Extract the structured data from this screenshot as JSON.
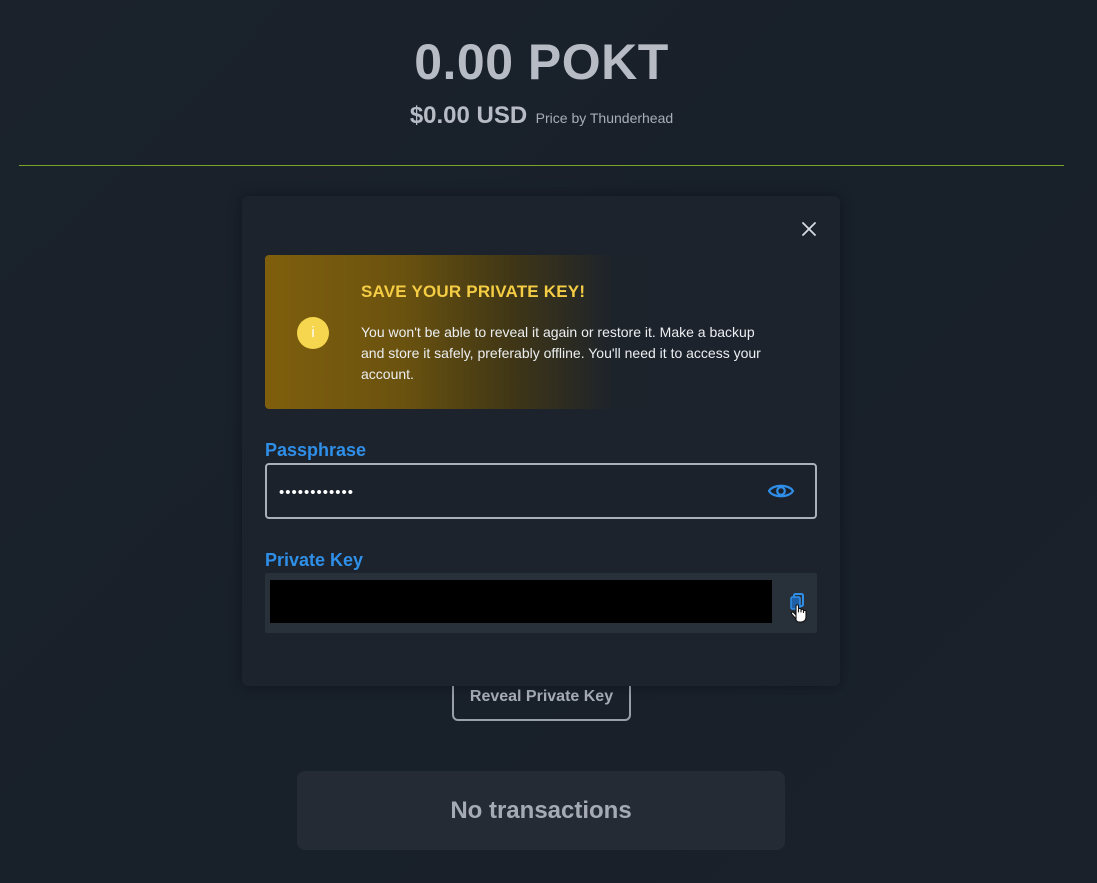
{
  "wallet": {
    "balance": "0.00 POKT",
    "usd_value": "$0.00 USD",
    "price_source": "Price by Thunderhead"
  },
  "actions": {
    "reveal_label": "Reveal Private Key"
  },
  "transactions": {
    "empty_label": "No transactions"
  },
  "modal": {
    "alert": {
      "icon": "info-icon",
      "icon_glyph": "i",
      "title": "SAVE YOUR PRIVATE KEY!",
      "message": "You won't be able to reveal it again or restore it. Make a backup and store it safely, preferably offline. You'll need it to access your account."
    },
    "passphrase": {
      "label": "Passphrase",
      "value": "••••••••••••"
    },
    "private_key": {
      "label": "Private Key",
      "value": ""
    }
  },
  "colors": {
    "accent_blue": "#2f8fe8",
    "warning_yellow": "#f5cd44",
    "divider_green": "#7aa32a"
  }
}
